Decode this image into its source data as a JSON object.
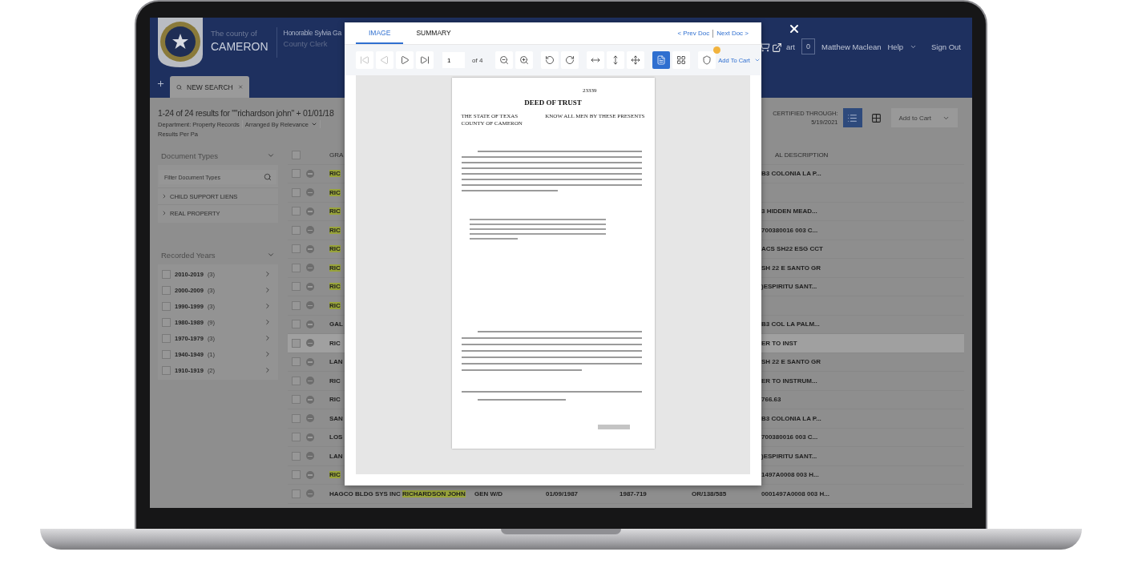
{
  "header": {
    "county_prefix": "The county of",
    "county_name": "CAMERON",
    "official": "Honorable Sylvia Ga",
    "official_title": "County Clerk",
    "cart_label": "art",
    "cart_count": "0",
    "user": "Matthew Maclean",
    "help": "Help",
    "sign_out": "Sign Out"
  },
  "search_tabs": [
    {
      "label": "NEW SEARCH",
      "selected": true
    }
  ],
  "results": {
    "summary": "1-24 of 24 results for \"\"richardson john\" + 01/01/18",
    "department": "Department: Property Records",
    "arranged": "Arranged By Relevance",
    "per_page": "Results Per Pa",
    "certified_label": "CERTIFIED THROUGH:",
    "certified_date": "5/19/2021",
    "add_to_cart": "Add to Cart"
  },
  "view_modes": [
    {
      "kind": "list",
      "selected": true
    },
    {
      "kind": "grid",
      "selected": false
    }
  ],
  "sidebar": {
    "sections": [
      {
        "title": "Document Types",
        "filter_placeholder": "Filter Document Types",
        "items": [
          {
            "label": "CHILD SUPPORT LIENS"
          },
          {
            "label": "REAL PROPERTY"
          }
        ]
      },
      {
        "title": "Recorded Years",
        "checks": [
          {
            "label": "2010-2019",
            "count": "(3)",
            "checked": false
          },
          {
            "label": "2000-2009",
            "count": "(3)",
            "checked": false
          },
          {
            "label": "1990-1999",
            "count": "(3)",
            "checked": false
          },
          {
            "label": "1980-1989",
            "count": "(9)",
            "checked": false
          },
          {
            "label": "1970-1979",
            "count": "(3)",
            "checked": false
          },
          {
            "label": "1940-1949",
            "count": "(1)",
            "checked": false
          },
          {
            "label": "1910-1919",
            "count": "(2)",
            "checked": false
          }
        ]
      }
    ]
  },
  "table": {
    "header": {
      "column_1": "GRA",
      "column_7": "AL DESCRIPTION",
      "checked": false
    },
    "rows": [
      {
        "checked": false,
        "selected": false,
        "column_1": {
          "text": "RIC",
          "highlighted": true
        },
        "column_7": {
          "text": "B3 COLONIA LA P...",
          "highlighted": false
        }
      },
      {
        "checked": false,
        "selected": false,
        "column_1": {
          "text": "RIC",
          "highlighted": true
        }
      },
      {
        "checked": false,
        "selected": false,
        "column_1": {
          "text": "RIC",
          "highlighted": true
        },
        "column_7": {
          "text": "3 HIDDEN MEAD...",
          "highlighted": false
        }
      },
      {
        "checked": false,
        "selected": false,
        "column_1": {
          "text": "RIC",
          "highlighted": true
        },
        "column_7": {
          "text": "700380016 003 C...",
          "highlighted": false
        }
      },
      {
        "checked": false,
        "selected": false,
        "column_1": {
          "text": "RIC",
          "highlighted": true
        },
        "column_7": {
          "text": "ACS SH22 ESG CCT",
          "highlighted": false
        }
      },
      {
        "checked": false,
        "selected": false,
        "column_1": {
          "text": "RIC",
          "highlighted": true
        },
        "column_7": {
          "text": "SH 22 E SANTO GR",
          "highlighted": false
        }
      },
      {
        "checked": false,
        "selected": false,
        "column_1": {
          "text": "RIC",
          "highlighted": true
        },
        "column_7": {
          "text": ")ESPIRITU SANT...",
          "highlighted": false
        }
      },
      {
        "checked": false,
        "selected": false,
        "column_1": {
          "text": "RIC",
          "highlighted": true
        }
      },
      {
        "checked": false,
        "selected": false,
        "column_1": {
          "text": "GAL",
          "highlighted": false
        },
        "column_7": {
          "text": "B3 COL LA PALM...",
          "highlighted": false
        }
      },
      {
        "checked": false,
        "selected": true,
        "column_1": {
          "text": "RIC",
          "highlighted": false
        },
        "column_7": {
          "text": "ER TO INST",
          "highlighted": false
        }
      },
      {
        "checked": false,
        "selected": false,
        "column_1": {
          "text": "LAN",
          "highlighted": false
        },
        "column_7": {
          "text": "SH 22 E SANTO GR",
          "highlighted": false
        }
      },
      {
        "checked": false,
        "selected": false,
        "column_1": {
          "text": "RIC",
          "highlighted": false
        },
        "column_7": {
          "text": "ER TO INSTRUM...",
          "highlighted": false
        }
      },
      {
        "checked": false,
        "selected": false,
        "column_1": {
          "text": "RIC",
          "highlighted": false
        },
        "column_7": {
          "text": "766.63",
          "highlighted": false
        }
      },
      {
        "checked": false,
        "selected": false,
        "column_1": {
          "text": "SAN",
          "highlighted": false
        },
        "column_7": {
          "text": "B3 COLONIA LA P...",
          "highlighted": false
        }
      },
      {
        "checked": false,
        "selected": false,
        "column_1": {
          "text": "LOS",
          "highlighted": false
        },
        "column_7": {
          "text": "700380016 003 C...",
          "highlighted": false
        }
      },
      {
        "checked": false,
        "selected": false,
        "column_1": {
          "text": "LAN",
          "highlighted": false
        },
        "column_7": {
          "text": ")ESPIRITU SANT...",
          "highlighted": false
        }
      },
      {
        "checked": false,
        "selected": false,
        "column_1": {
          "text": "RIC",
          "highlighted": true
        },
        "column_7": {
          "text": "1497A0008 003 H...",
          "highlighted": false
        }
      },
      {
        "checked": false,
        "selected": false,
        "column_1": {
          "text": "HAGCO BLDG SYS INC",
          "highlighted": false
        },
        "column_2": {
          "text": "RICHARDSON JOHN",
          "highlighted": true
        },
        "column_3": {
          "text": "GEN W/D",
          "highlighted": false
        },
        "column_4": {
          "text": "01/09/1987",
          "highlighted": false
        },
        "column_5": {
          "text": "1987-719",
          "highlighted": false
        },
        "column_6": {
          "text": "OR/138/585",
          "highlighted": false
        },
        "column_7": {
          "text": "0001497A0008 003 H...",
          "highlighted": false
        }
      }
    ]
  },
  "viewer": {
    "tabs": [
      {
        "label": "IMAGE",
        "selected": true
      },
      {
        "label": "SUMMARY",
        "selected": false
      }
    ],
    "prev_doc": "< Prev Doc",
    "next_doc": "Next Doc >",
    "tools": [
      {
        "kind": "first",
        "disabled": true
      },
      {
        "kind": "prev",
        "disabled": true
      },
      {
        "kind": "next",
        "disabled": false
      },
      {
        "kind": "last",
        "disabled": false
      },
      {
        "kind": "page"
      },
      {
        "kind": "zoom_out",
        "disabled": false
      },
      {
        "kind": "zoom_in",
        "disabled": false
      },
      {
        "kind": "rotate_left",
        "disabled": false
      },
      {
        "kind": "rotate_right",
        "disabled": false
      },
      {
        "kind": "fit_width",
        "disabled": false
      },
      {
        "kind": "fit_height",
        "disabled": false
      },
      {
        "kind": "pan",
        "disabled": false
      },
      {
        "kind": "single_page",
        "selected": true
      },
      {
        "kind": "thumbnails",
        "selected": false
      },
      {
        "kind": "redact",
        "notification": true
      }
    ],
    "page_number": "1",
    "page_total": "of 4",
    "add_to_cart": "Add To Cart",
    "document": {
      "number": "23339",
      "title": "DEED OF TRUST",
      "state": "THE STATE OF TEXAS",
      "county": "COUNTY OF CAMERON",
      "preamble": "KNOW ALL MEN BY THESE PRESENTS"
    }
  }
}
